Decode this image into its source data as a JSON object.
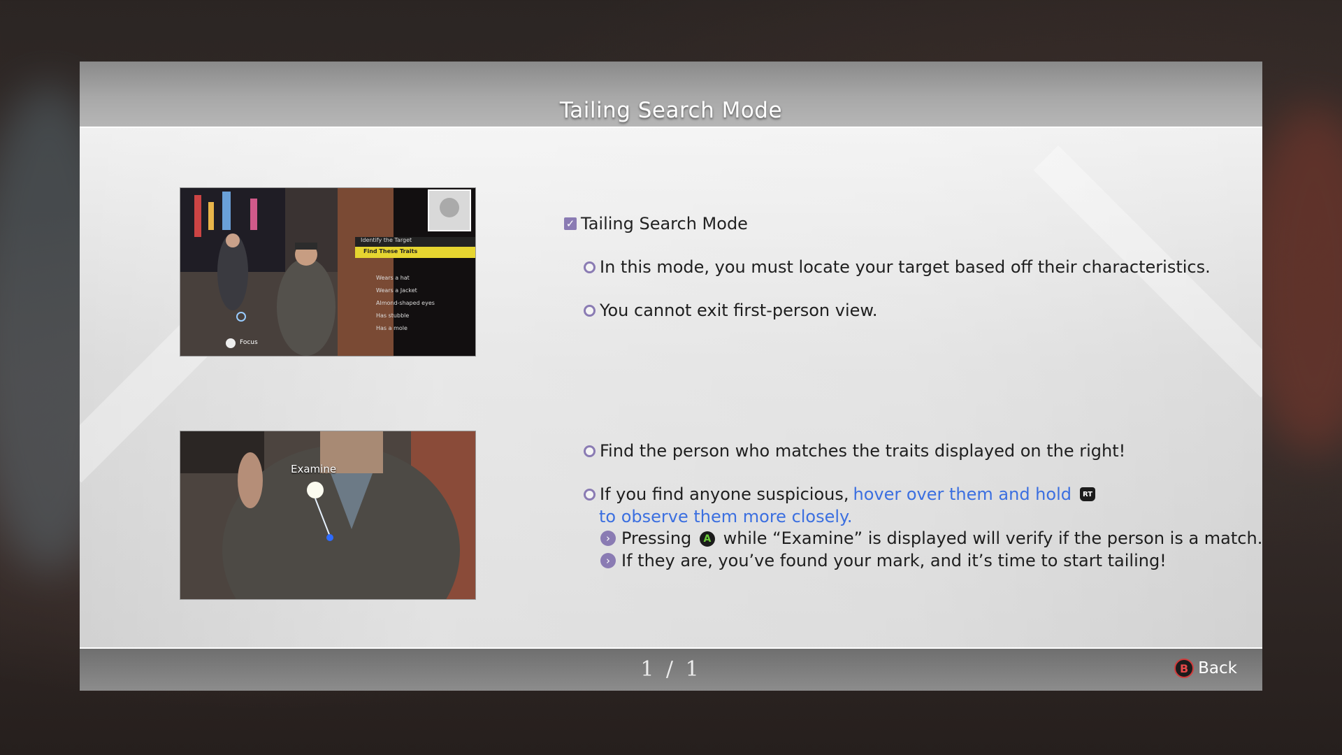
{
  "header": {
    "title": "Tailing Search Mode"
  },
  "section": {
    "title": "Tailing Search Mode",
    "checked": true
  },
  "bullets": [
    "In this mode, you must locate your target based off their characteristics.",
    "You cannot exit first-person view.",
    "Find the person who matches the traits displayed on the right!"
  ],
  "suspicious": {
    "prefix": "If you find anyone suspicious,",
    "highlight1": "hover over them and hold",
    "button_icon": "RT",
    "highlight2": "to observe them more closely."
  },
  "sub_items": {
    "pressing_prefix": "Pressing",
    "pressing_button": "A",
    "pressing_suffix": "while “Examine” is displayed will verify if the person is a match.",
    "found": "If they are, you’ve found your mark, and it’s time to start tailing!"
  },
  "screenshot1": {
    "panel_title": "Identify the Target",
    "panel_subtitle": "Find These Traits",
    "traits": [
      "Wears a hat",
      "Wears a Jacket",
      "Almond-shaped eyes",
      "Has stubble",
      "Has a mole"
    ],
    "focus_label": "Focus"
  },
  "screenshot2": {
    "label": "Examine"
  },
  "footer": {
    "page": "1 / 1",
    "back_label": "Back",
    "back_button": "B"
  },
  "colors": {
    "accent": "#8a7bb3",
    "highlight": "#3b6fe0"
  }
}
